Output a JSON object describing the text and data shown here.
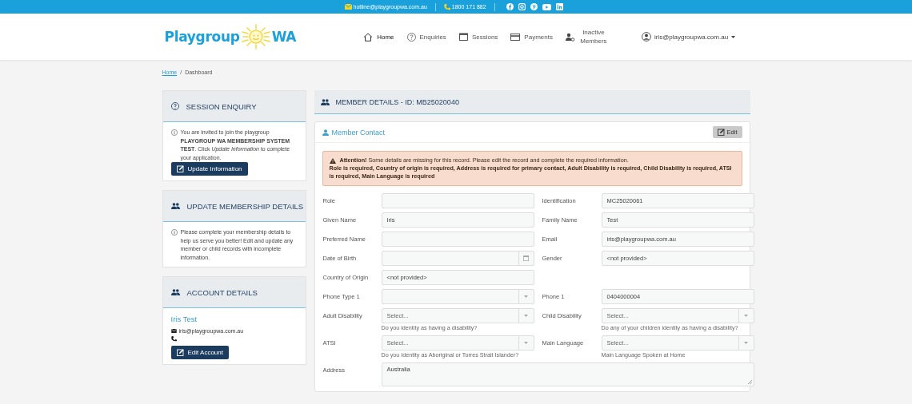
{
  "top_bar": {
    "email": "hotline@playgroupwa.com.au",
    "phone": "1800 171 882"
  },
  "header": {
    "logo_left": "Playgroup",
    "logo_right": "WA",
    "nav": [
      {
        "label": "Home",
        "selected": true
      },
      {
        "label": "Enquiries",
        "selected": false
      },
      {
        "label": "Sessions",
        "selected": false
      },
      {
        "label": "Payments",
        "selected": false
      },
      {
        "label": "Inactive Members",
        "selected": false
      }
    ],
    "account": "iris@playgroupwa.com.au"
  },
  "breadcrumb": {
    "link": "Home",
    "separator": "/",
    "current": "Dashboard"
  },
  "sidebar": [
    {
      "title": "SESSION ENQUIRY",
      "text": "You are invited to join the playgroup **PLAYGROUP WA MEMBERSHIP SYSTEM TEST**. Click *Update Information* to complete your application.",
      "button": "Update Information"
    },
    {
      "title": "UPDATE MEMBERSHIP DETAILS",
      "text": "Please complete your membership details to help us serve you better! Edit and update any member or child records with incomplete information."
    },
    {
      "title": "ACCOUNT DETAILS",
      "name": "Iris Test",
      "email": "iris@playgroupwa.com.au",
      "button": "Edit Account"
    }
  ],
  "main": {
    "title": "MEMBER DETAILS - ID: MB25020040",
    "card_title": "Member Contact",
    "edit_button": "Edit",
    "alert": {
      "message": "**Attention!** Some details are missing for this record. Please edit the record and complete the required information.",
      "details": "Role is required, Country of origin is required, Address is required for primary contact, Adult Disability is required, Child Disability is required, ATSI is required, Main Language is required"
    },
    "rows": [
      [
        {
          "label": "Role",
          "kind": "text"
        },
        {
          "label": "Identification",
          "kind": "text",
          "value": "MC25020061"
        }
      ],
      [
        {
          "label": "Given Name",
          "kind": "text",
          "value": "Iris"
        },
        {
          "label": "Family Name",
          "kind": "text",
          "value": "Test"
        }
      ],
      [
        {
          "label": "Preferred Name",
          "kind": "text"
        },
        {
          "label": "Email",
          "kind": "text",
          "value": "iris@playgroupwa.com.au"
        }
      ],
      [
        {
          "label": "Date of Birth",
          "kind": "date"
        },
        {
          "label": "Gender",
          "kind": "text",
          "value": "<not provided>"
        }
      ],
      [
        {
          "label": "Country of Origin",
          "kind": "text",
          "value": "<not provided>"
        }
      ],
      [
        {
          "label": "Phone Type 1",
          "kind": "select"
        },
        {
          "label": "Phone 1",
          "kind": "text",
          "value": "0404000004"
        }
      ],
      [
        {
          "label": "Adult Disability",
          "kind": "select",
          "placeholder": "Select...",
          "hint": "Do you identity as having a disability?"
        },
        {
          "label": "Child Disability",
          "kind": "select",
          "placeholder": "Select...",
          "hint": "Do any of your children identity as having a disability?"
        }
      ],
      [
        {
          "label": "ATSI",
          "kind": "select",
          "placeholder": "Select...",
          "hint": "Do you Identity as Aboriginal or Torres Strait Islander?"
        },
        {
          "label": "Main Language",
          "kind": "select",
          "placeholder": "Select...",
          "hint": "Main Language Spoken at Home"
        }
      ],
      [
        {
          "label": "Address",
          "kind": "textarea",
          "value": "Australia"
        }
      ]
    ]
  }
}
